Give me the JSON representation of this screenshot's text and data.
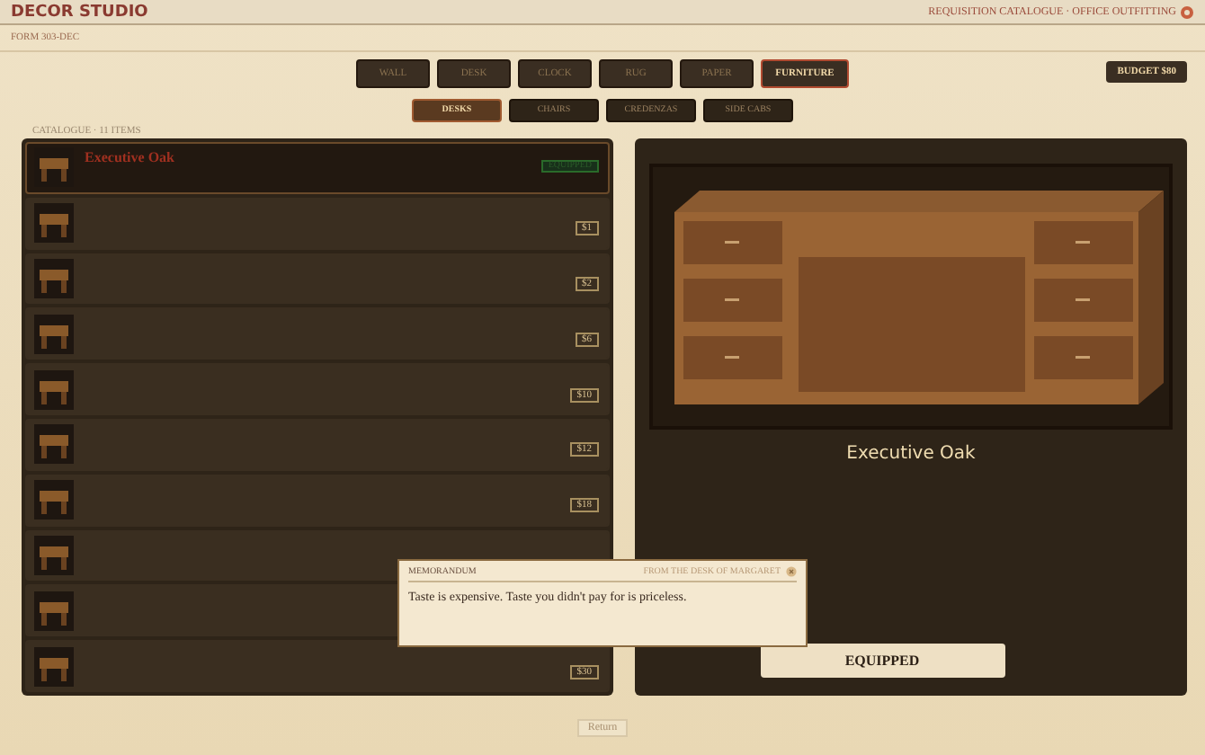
{
  "header": {
    "title": "DECOR STUDIO",
    "subtitle": "REQUISITION CATALOGUE · OFFICE OUTFITTING",
    "form": "FORM 303-DEC"
  },
  "tabs": [
    {
      "label": "WALL",
      "selected": false
    },
    {
      "label": "DESK",
      "selected": false
    },
    {
      "label": "CLOCK",
      "selected": false
    },
    {
      "label": "RUG",
      "selected": false
    },
    {
      "label": "PAPER",
      "selected": false
    },
    {
      "label": "FURNITURE",
      "selected": true
    }
  ],
  "budget": "BUDGET $80",
  "subtabs": [
    {
      "label": "DESKS",
      "selected": true
    },
    {
      "label": "CHAIRS",
      "selected": false
    },
    {
      "label": "CREDENZAS",
      "selected": false
    },
    {
      "label": "SIDE CABS",
      "selected": false
    }
  ],
  "catalogue": {
    "label": "CATALOGUE · 11 ITEMS",
    "items": [
      {
        "name": "Executive Oak",
        "badge": "EQUIPPED",
        "selected": true
      },
      {
        "price": "$1",
        "selected": false
      },
      {
        "price": "$2",
        "selected": false
      },
      {
        "price": "$6",
        "selected": false
      },
      {
        "price": "$10",
        "selected": false
      },
      {
        "price": "$12",
        "selected": false
      },
      {
        "price": "$18",
        "selected": false
      },
      {
        "selected": false
      },
      {
        "selected": false
      },
      {
        "price": "$30",
        "selected": false
      }
    ]
  },
  "preview": {
    "title": "Executive Oak",
    "button": "EQUIPPED"
  },
  "memo": {
    "heading": "MEMORANDUM",
    "from": "FROM THE DESK OF MARGARET",
    "text": "Taste is expensive. Taste you didn't pay for is priceless."
  },
  "return_button": "Return"
}
